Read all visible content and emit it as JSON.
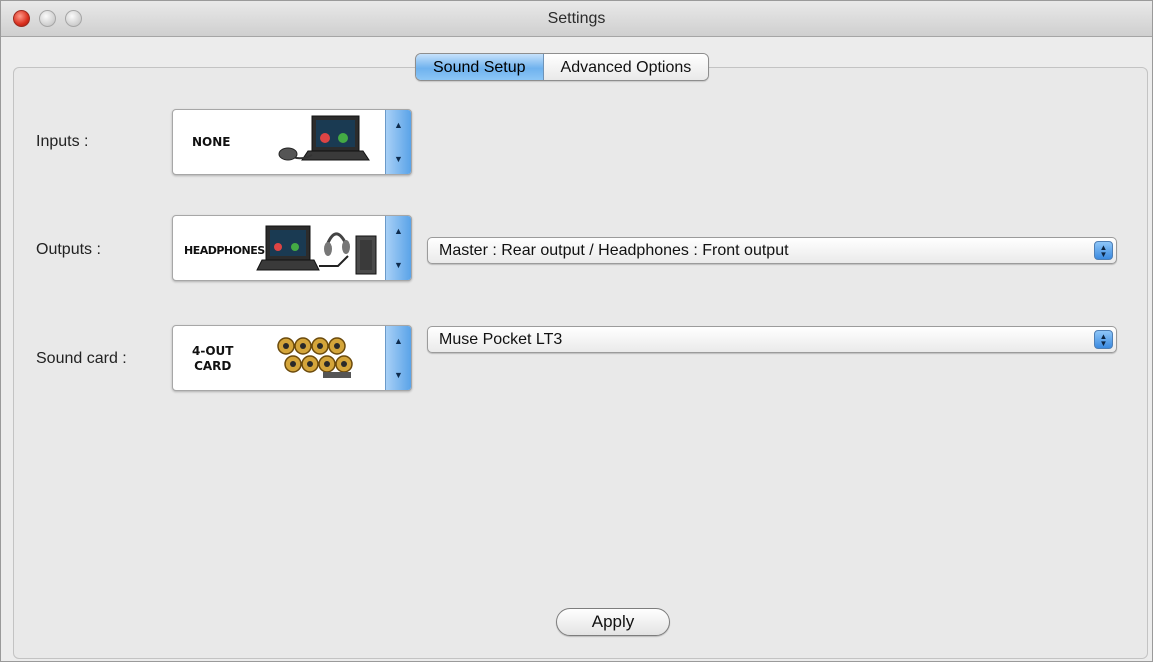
{
  "window": {
    "title": "Settings"
  },
  "tabs": [
    {
      "label": "Sound Setup",
      "active": true
    },
    {
      "label": "Advanced Options",
      "active": false
    }
  ],
  "rows": {
    "inputs": {
      "label": "Inputs :",
      "selector_text": "NONE"
    },
    "outputs": {
      "label": "Outputs :",
      "selector_text": "HEADPHONES",
      "dropdown_value": "Master : Rear output / Headphones : Front output"
    },
    "soundcard": {
      "label": "Sound card :",
      "selector_text_line1": "4-OUT",
      "selector_text_line2": "CARD",
      "dropdown_value": "Muse Pocket LT3"
    }
  },
  "buttons": {
    "apply": "Apply"
  },
  "icons": {
    "stepper_up": "▲",
    "stepper_down": "▼",
    "combo_arrows": "▲▼"
  },
  "colors": {
    "accent": "#5aa3e8",
    "window_bg": "#ececec",
    "close_button": "#d9301f"
  }
}
